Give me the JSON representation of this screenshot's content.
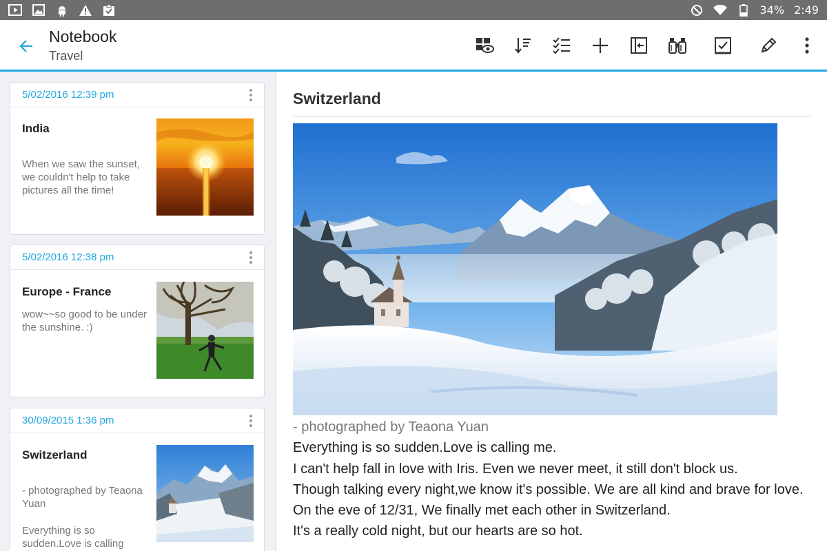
{
  "status_bar": {
    "battery": "34%",
    "time": "2:49",
    "left_icons": [
      "video-icon",
      "image-icon",
      "android-icon",
      "warning-icon",
      "clipboard-check-icon"
    ],
    "right_icons": [
      "do-not-disturb-icon",
      "wifi-icon",
      "battery-icon"
    ]
  },
  "app_bar": {
    "title": "Notebook",
    "subtitle": "Travel",
    "accent_color": "#1fa6e0",
    "tools": [
      "view-mode-icon",
      "sort-icon",
      "checklist-icon",
      "add-icon",
      "collapse-panel-icon",
      "binoculars-icon",
      "checkbox-icon",
      "edit-icon",
      "more-vertical-icon"
    ]
  },
  "notes": [
    {
      "date": "5/02/2016 12:39 pm",
      "title": "India",
      "text": "When we saw the sunset, we couldn't help to take pictures all the time!"
    },
    {
      "date": "5/02/2016 12:38 pm",
      "title": "Europe - France",
      "text": "wow~~so good to be under the sunshine. :)"
    },
    {
      "date": "30/09/2015 1:36 pm",
      "title": "Switzerland",
      "text": "- photographed by Teaona Yuan",
      "text2": "Everything is so sudden.Love is calling"
    }
  ],
  "detail": {
    "title": "Switzerland",
    "caption": "- photographed by Teaona Yuan",
    "lines": [
      "Everything is so sudden.Love is calling me.",
      "I can't help fall in love with Iris. Even we never meet, it still don't block us.",
      "Though talking every night,we know it's possible. We are all kind and brave for love.",
      "On the eve of 12/31, We finally met each other in Switzerland.",
      "It's a really cold night, but our hearts are so hot."
    ]
  }
}
